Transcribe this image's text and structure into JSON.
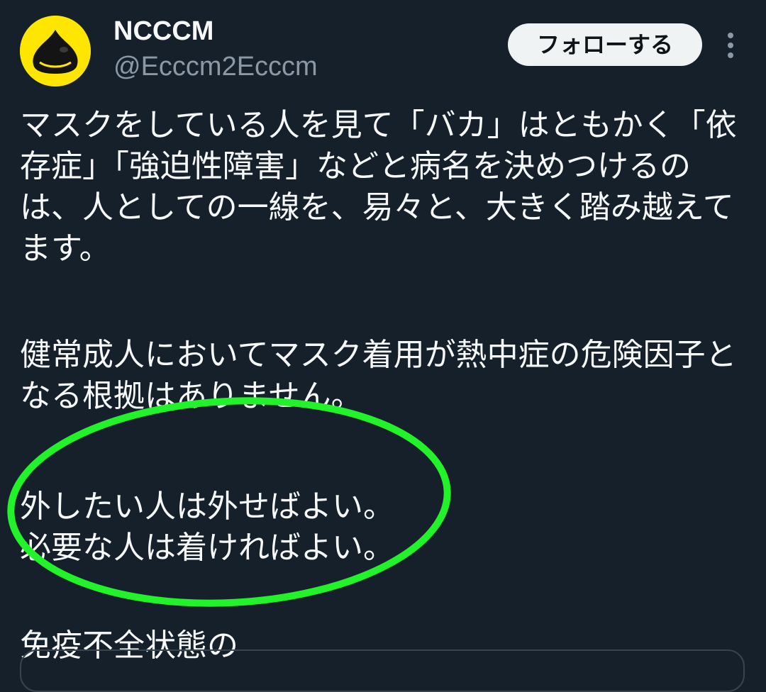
{
  "tweet": {
    "author": {
      "display_name": "NCCCM",
      "handle": "@Ecccm2Ecccm",
      "avatar_icon": "slime-avatar-icon"
    },
    "follow_label": "フォローする",
    "more_icon": "more-options-icon",
    "paragraphs": [
      "マスクをしている人を見て「バカ」はともかく「依存症」「強迫性障害」などと病名を決めつけるのは、人としての一線を、易々と、大きく踏み越えてます。",
      "健常成人においてマスク着用が熱中症の危険因子となる根拠はありません。",
      "外したい人は外せばよい。\n必要な人は着ければよい。",
      "免疫不全状態の"
    ]
  },
  "colors": {
    "background": "#15202b",
    "text": "#f7f9f9",
    "secondary_text": "#8b98a5",
    "follow_button_bg": "#eff3f4",
    "highlight_ellipse": "#22f22a",
    "avatar_bg": "#ffe600"
  }
}
